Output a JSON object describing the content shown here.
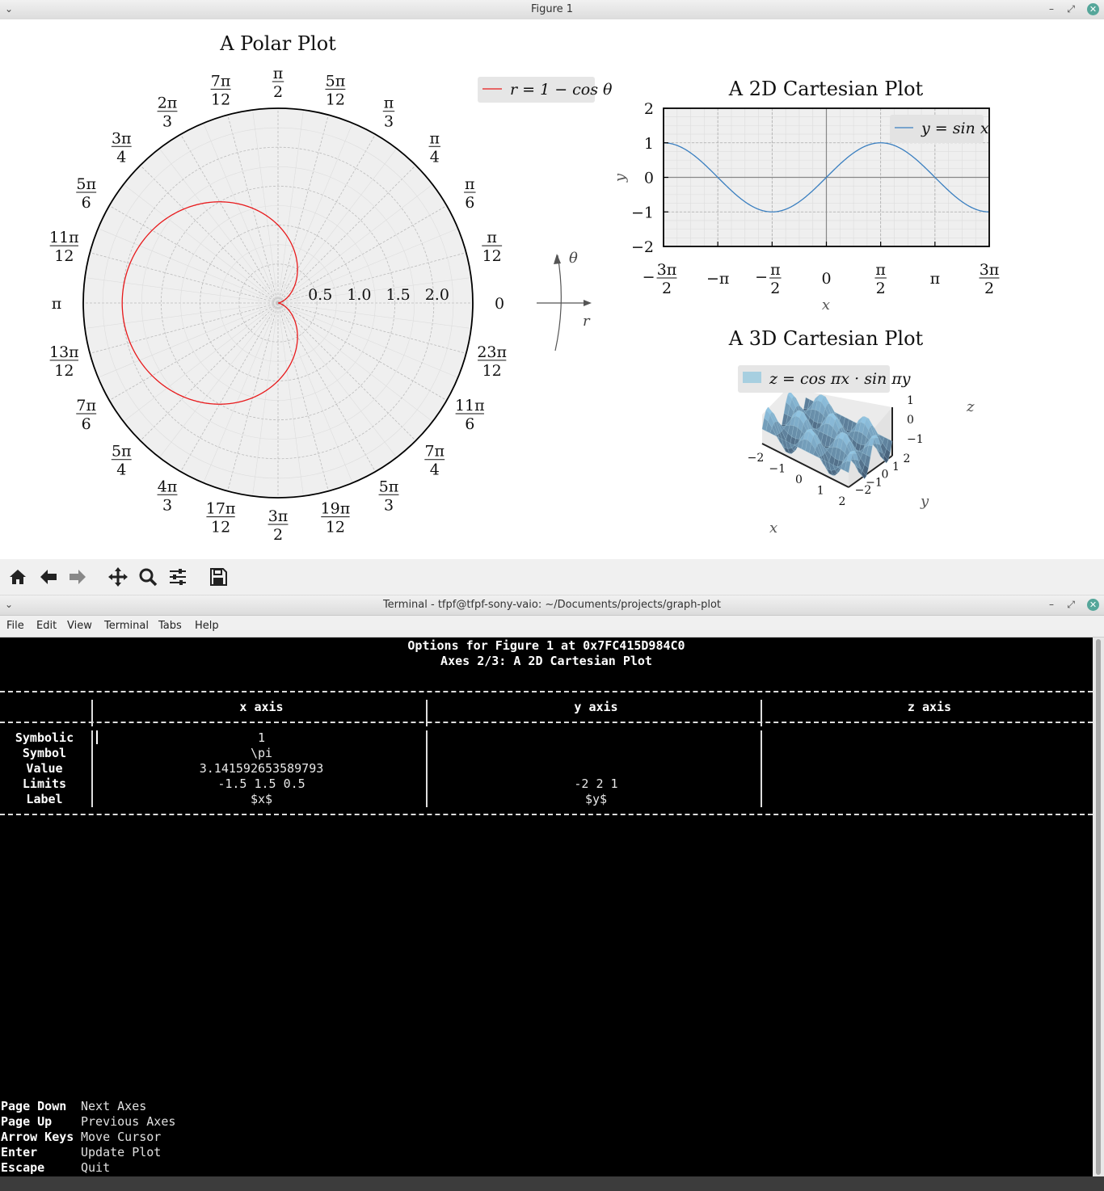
{
  "figure_window": {
    "title": "Figure 1"
  },
  "toolbar": {
    "buttons": [
      "home-icon",
      "back-arrow-icon",
      "forward-arrow-icon",
      "pan-icon",
      "zoom-icon",
      "configure-icon",
      "save-icon"
    ]
  },
  "polar_plot": {
    "title": "A Polar Plot",
    "legend": "r = 1 − cos θ",
    "radial_ticks": [
      "0.5",
      "1.0",
      "1.5",
      "2.0"
    ],
    "angle_labels": [
      {
        "num": "",
        "den": "",
        "plain": "0"
      },
      {
        "num": "π",
        "den": "12",
        "plain": ""
      },
      {
        "num": "π",
        "den": "6",
        "plain": ""
      },
      {
        "num": "π",
        "den": "4",
        "plain": ""
      },
      {
        "num": "π",
        "den": "3",
        "plain": ""
      },
      {
        "num": "5π",
        "den": "12",
        "plain": ""
      },
      {
        "num": "π",
        "den": "2",
        "plain": ""
      },
      {
        "num": "7π",
        "den": "12",
        "plain": ""
      },
      {
        "num": "2π",
        "den": "3",
        "plain": ""
      },
      {
        "num": "3π",
        "den": "4",
        "plain": ""
      },
      {
        "num": "5π",
        "den": "6",
        "plain": ""
      },
      {
        "num": "11π",
        "den": "12",
        "plain": ""
      },
      {
        "num": "",
        "den": "",
        "plain": "π"
      },
      {
        "num": "13π",
        "den": "12",
        "plain": ""
      },
      {
        "num": "7π",
        "den": "6",
        "plain": ""
      },
      {
        "num": "5π",
        "den": "4",
        "plain": ""
      },
      {
        "num": "4π",
        "den": "3",
        "plain": ""
      },
      {
        "num": "17π",
        "den": "12",
        "plain": ""
      },
      {
        "num": "3π",
        "den": "2",
        "plain": ""
      },
      {
        "num": "19π",
        "den": "12",
        "plain": ""
      },
      {
        "num": "5π",
        "den": "3",
        "plain": ""
      },
      {
        "num": "7π",
        "den": "4",
        "plain": ""
      },
      {
        "num": "11π",
        "den": "6",
        "plain": ""
      },
      {
        "num": "23π",
        "den": "12",
        "plain": ""
      }
    ],
    "theta_label": "θ",
    "r_label": "r",
    "curve_color": "#e8191b"
  },
  "chart_data": [
    {
      "type": "line",
      "title": "A 2D Cartesian Plot",
      "xlabel": "x",
      "ylabel": "y",
      "xlim": [
        -4.712,
        4.712
      ],
      "ylim": [
        -2,
        2
      ],
      "x_ticks": [
        {
          "v": -4.712,
          "num": "3π",
          "den": "2",
          "sign": "−"
        },
        {
          "v": -3.1416,
          "plain": "−π"
        },
        {
          "v": -1.5708,
          "num": "π",
          "den": "2",
          "sign": "−"
        },
        {
          "v": 0,
          "plain": "0"
        },
        {
          "v": 1.5708,
          "num": "π",
          "den": "2",
          "sign": ""
        },
        {
          "v": 3.1416,
          "plain": "π"
        },
        {
          "v": 4.712,
          "num": "3π",
          "den": "2",
          "sign": ""
        }
      ],
      "y_ticks": [
        {
          "v": 2,
          "label": "2"
        },
        {
          "v": 1,
          "label": "1"
        },
        {
          "v": 0,
          "label": "0"
        },
        {
          "v": -1,
          "label": "−1"
        },
        {
          "v": -2,
          "label": "−2"
        }
      ],
      "series": [
        {
          "name": "y = sin x",
          "function": "sin",
          "color": "#3a7fc0"
        }
      ],
      "legend": "top-right",
      "grid": true
    }
  ],
  "surface_plot": {
    "title": "A 3D Cartesian Plot",
    "legend": "z = cos πx · sin πy",
    "x_ticks": [
      "−2",
      "−1",
      "0",
      "1",
      "2"
    ],
    "y_ticks": [
      "−2",
      "−1",
      "0",
      "1",
      "2"
    ],
    "z_ticks": [
      "1",
      "0",
      "−1"
    ],
    "xlabel": "x",
    "ylabel": "y",
    "zlabel": "z",
    "surface_color": "#a7cfe0"
  },
  "terminal_window": {
    "title": "Terminal - tfpf@tfpf-sony-vaio: ~/Documents/projects/graph-plot",
    "menu": [
      "File",
      "Edit",
      "View",
      "Terminal",
      "Tabs",
      "Help"
    ]
  },
  "terminal": {
    "header_line1": "Options for Figure 1 at 0x7FC415D984C0",
    "header_line2": "Axes 2/3: A 2D Cartesian Plot",
    "columns": [
      "x axis",
      "y axis",
      "z axis"
    ],
    "rows": [
      {
        "label": "Symbolic",
        "x": "1",
        "y": "",
        "z": ""
      },
      {
        "label": "Symbol",
        "x": "\\pi",
        "y": "",
        "z": ""
      },
      {
        "label": "Value",
        "x": "3.141592653589793",
        "y": "",
        "z": ""
      },
      {
        "label": "Limits",
        "x": "-1.5 1.5 0.5",
        "y": "-2 2 1",
        "z": ""
      },
      {
        "label": "Label",
        "x": "$x$",
        "y": "$y$",
        "z": ""
      }
    ],
    "keys": [
      {
        "key": "Page Down",
        "desc": "Next Axes"
      },
      {
        "key": "Page Up",
        "desc": "Previous Axes"
      },
      {
        "key": "Arrow Keys",
        "desc": "Move Cursor"
      },
      {
        "key": "Enter",
        "desc": "Update Plot"
      },
      {
        "key": "Escape",
        "desc": "Quit"
      }
    ]
  }
}
